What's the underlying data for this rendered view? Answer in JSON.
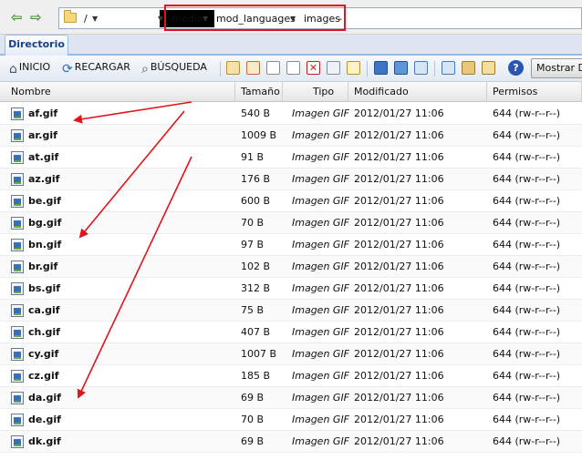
{
  "pathbar": {
    "root": "/",
    "segments": [
      "media",
      "mod_languages",
      "images"
    ]
  },
  "tabs": [
    "Directorio"
  ],
  "toolbar": {
    "home": "INICIO",
    "reload": "RECARGAR",
    "search": "BÚSQUEDA",
    "show": "Mostrar Di"
  },
  "columns": [
    "Nombre",
    "Tamaño",
    "Tipo",
    "Modificado",
    "Permisos"
  ],
  "files": [
    {
      "name": "af.gif",
      "size": "540 B",
      "type": "Imagen GIF",
      "modified": "2012/01/27 11:06",
      "perms": "644 (rw-r--r--)"
    },
    {
      "name": "ar.gif",
      "size": "1009 B",
      "type": "Imagen GIF",
      "modified": "2012/01/27 11:06",
      "perms": "644 (rw-r--r--)"
    },
    {
      "name": "at.gif",
      "size": "91 B",
      "type": "Imagen GIF",
      "modified": "2012/01/27 11:06",
      "perms": "644 (rw-r--r--)"
    },
    {
      "name": "az.gif",
      "size": "176 B",
      "type": "Imagen GIF",
      "modified": "2012/01/27 11:06",
      "perms": "644 (rw-r--r--)"
    },
    {
      "name": "be.gif",
      "size": "600 B",
      "type": "Imagen GIF",
      "modified": "2012/01/27 11:06",
      "perms": "644 (rw-r--r--)"
    },
    {
      "name": "bg.gif",
      "size": "70 B",
      "type": "Imagen GIF",
      "modified": "2012/01/27 11:06",
      "perms": "644 (rw-r--r--)"
    },
    {
      "name": "bn.gif",
      "size": "97 B",
      "type": "Imagen GIF",
      "modified": "2012/01/27 11:06",
      "perms": "644 (rw-r--r--)"
    },
    {
      "name": "br.gif",
      "size": "102 B",
      "type": "Imagen GIF",
      "modified": "2012/01/27 11:06",
      "perms": "644 (rw-r--r--)"
    },
    {
      "name": "bs.gif",
      "size": "312 B",
      "type": "Imagen GIF",
      "modified": "2012/01/27 11:06",
      "perms": "644 (rw-r--r--)"
    },
    {
      "name": "ca.gif",
      "size": "75 B",
      "type": "Imagen GIF",
      "modified": "2012/01/27 11:06",
      "perms": "644 (rw-r--r--)"
    },
    {
      "name": "ch.gif",
      "size": "407 B",
      "type": "Imagen GIF",
      "modified": "2012/01/27 11:06",
      "perms": "644 (rw-r--r--)"
    },
    {
      "name": "cy.gif",
      "size": "1007 B",
      "type": "Imagen GIF",
      "modified": "2012/01/27 11:06",
      "perms": "644 (rw-r--r--)"
    },
    {
      "name": "cz.gif",
      "size": "185 B",
      "type": "Imagen GIF",
      "modified": "2012/01/27 11:06",
      "perms": "644 (rw-r--r--)"
    },
    {
      "name": "da.gif",
      "size": "69 B",
      "type": "Imagen GIF",
      "modified": "2012/01/27 11:06",
      "perms": "644 (rw-r--r--)"
    },
    {
      "name": "de.gif",
      "size": "70 B",
      "type": "Imagen GIF",
      "modified": "2012/01/27 11:06",
      "perms": "644 (rw-r--r--)"
    },
    {
      "name": "dk.gif",
      "size": "69 B",
      "type": "Imagen GIF",
      "modified": "2012/01/27 11:06",
      "perms": "644 (rw-r--r--)"
    }
  ],
  "colors": {
    "accent": "#15428b",
    "highlight": "#e4121a",
    "nav_arrow": "#3b9a28"
  },
  "icons": {
    "back": "arrow-left-icon",
    "forward": "arrow-right-icon",
    "home": "home-icon",
    "reload": "refresh-icon",
    "search": "magnifier-icon",
    "help": "help-icon",
    "file": "gif-image-icon"
  }
}
